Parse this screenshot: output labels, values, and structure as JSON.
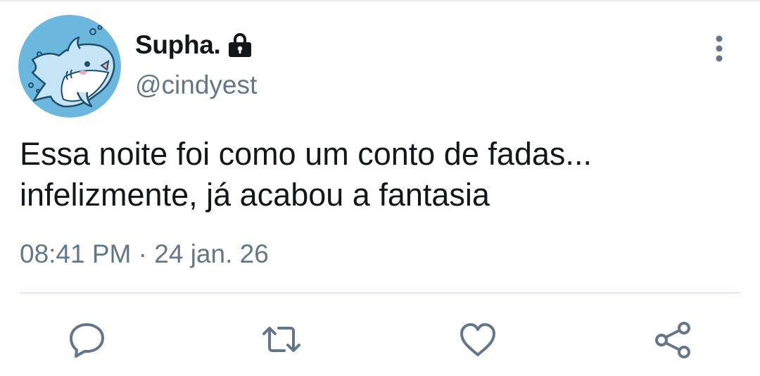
{
  "tweet": {
    "display_name": "Supha.",
    "handle": "@cindyest",
    "text": "Essa noite foi como um conto de fadas...\ninfelizmente, já acabou a fantasia",
    "time": "08:41 PM",
    "separator": " · ",
    "date": "24 jan. 26",
    "protected_icon": "lock-icon",
    "avatar": "shark-avatar"
  },
  "actions": [
    {
      "name": "reply",
      "icon": "speech-bubble-icon"
    },
    {
      "name": "retweet",
      "icon": "retweet-arrows-icon"
    },
    {
      "name": "like",
      "icon": "heart-icon"
    },
    {
      "name": "share",
      "icon": "share-icon"
    }
  ],
  "colors": {
    "primary_text": "#14171a",
    "secondary_text": "#657786",
    "icon": "#657786",
    "avatar_bg": "#6bb7de",
    "divider": "#e1e8ed"
  }
}
